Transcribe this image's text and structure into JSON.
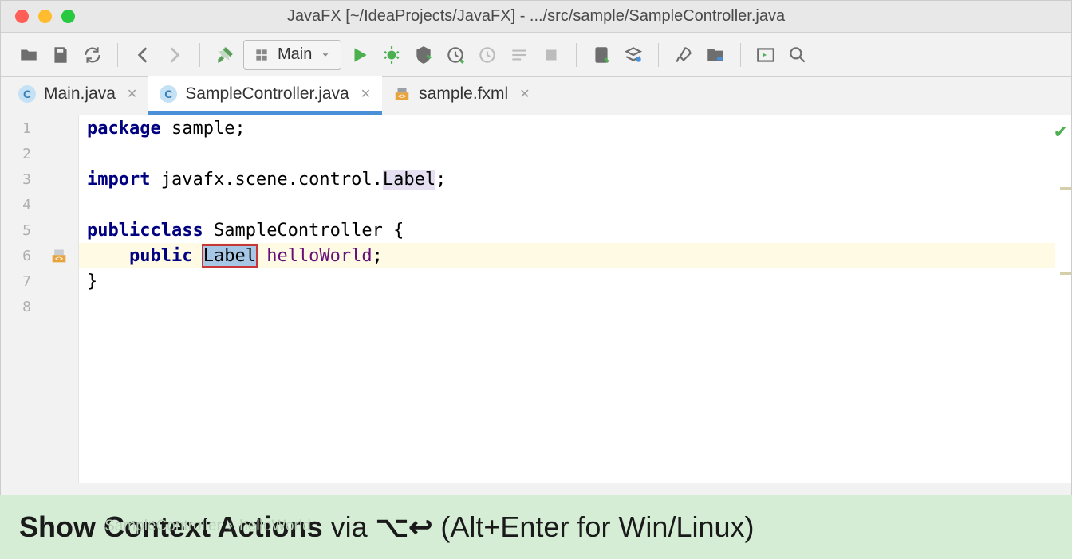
{
  "window": {
    "title": "JavaFX [~/IdeaProjects/JavaFX] - .../src/sample/SampleController.java"
  },
  "runconfig": {
    "label": "Main"
  },
  "tabs": [
    {
      "label": "Main.java",
      "icon": "C",
      "active": false
    },
    {
      "label": "SampleController.java",
      "icon": "C",
      "active": true
    },
    {
      "label": "sample.fxml",
      "icon": "<>",
      "active": false
    }
  ],
  "code": {
    "lines": [
      "1",
      "2",
      "3",
      "4",
      "5",
      "6",
      "7",
      "8"
    ],
    "l1": {
      "kw": "package",
      "rest": " sample;"
    },
    "l3": {
      "kw": "import",
      "mid": " javafx.scene.control.",
      "hl": "Label",
      "end": ";"
    },
    "l5": {
      "kw1": "public",
      "kw2": "class",
      "name": " SampleController ",
      "brace": "{"
    },
    "l6": {
      "indent": "    ",
      "kw": "public",
      "sp": " ",
      "type": "Label",
      "sp2": " ",
      "field": "helloWorld",
      "end": ";"
    },
    "l7": {
      "brace": "}"
    }
  },
  "hint": {
    "strong": "Show Context Actions",
    "via": " via ",
    "shortcut_mac": "⌥↩",
    "rest": " (Alt+Enter for Win/Linux)"
  },
  "breadcrumb": {
    "a": "SampleController",
    "b": "helloWorld"
  }
}
